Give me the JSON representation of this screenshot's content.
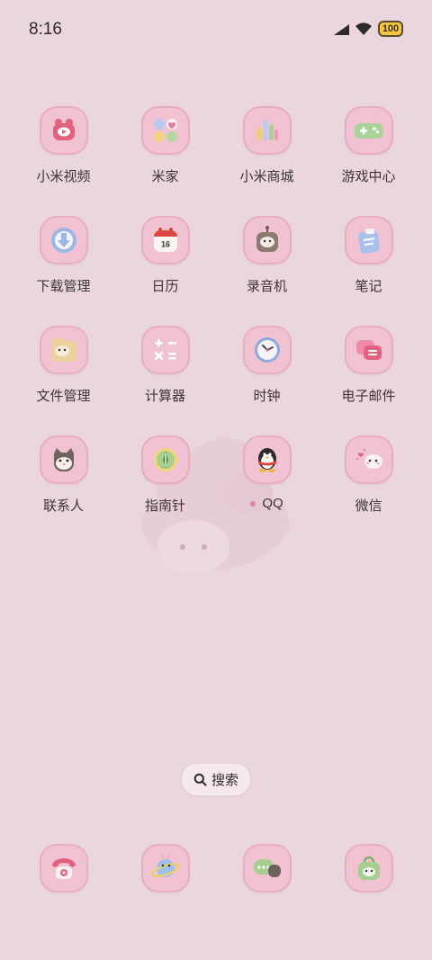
{
  "status_bar": {
    "time": "8:16",
    "battery": "100"
  },
  "apps": [
    [
      {
        "label": "小米视频",
        "icon": "video-icon"
      },
      {
        "label": "米家",
        "icon": "mijia-icon"
      },
      {
        "label": "小米商城",
        "icon": "mall-icon"
      },
      {
        "label": "游戏中心",
        "icon": "gamepad-icon"
      }
    ],
    [
      {
        "label": "下载管理",
        "icon": "download-icon"
      },
      {
        "label": "日历",
        "icon": "calendar-icon",
        "calendar_day": "16"
      },
      {
        "label": "录音机",
        "icon": "recorder-icon"
      },
      {
        "label": "笔记",
        "icon": "notes-icon"
      }
    ],
    [
      {
        "label": "文件管理",
        "icon": "folder-icon"
      },
      {
        "label": "计算器",
        "icon": "calculator-icon"
      },
      {
        "label": "时钟",
        "icon": "clock-icon"
      },
      {
        "label": "电子邮件",
        "icon": "mail-icon"
      }
    ],
    [
      {
        "label": "联系人",
        "icon": "contacts-icon"
      },
      {
        "label": "指南针",
        "icon": "compass-icon"
      },
      {
        "label": "QQ",
        "icon": "qq-icon",
        "notification_dot": true
      },
      {
        "label": "微信",
        "icon": "wechat-icon"
      }
    ]
  ],
  "search": {
    "label": "搜索"
  },
  "dock": [
    {
      "icon": "phone-icon"
    },
    {
      "icon": "browser-icon"
    },
    {
      "icon": "messages-icon"
    },
    {
      "icon": "app-store-icon"
    }
  ]
}
